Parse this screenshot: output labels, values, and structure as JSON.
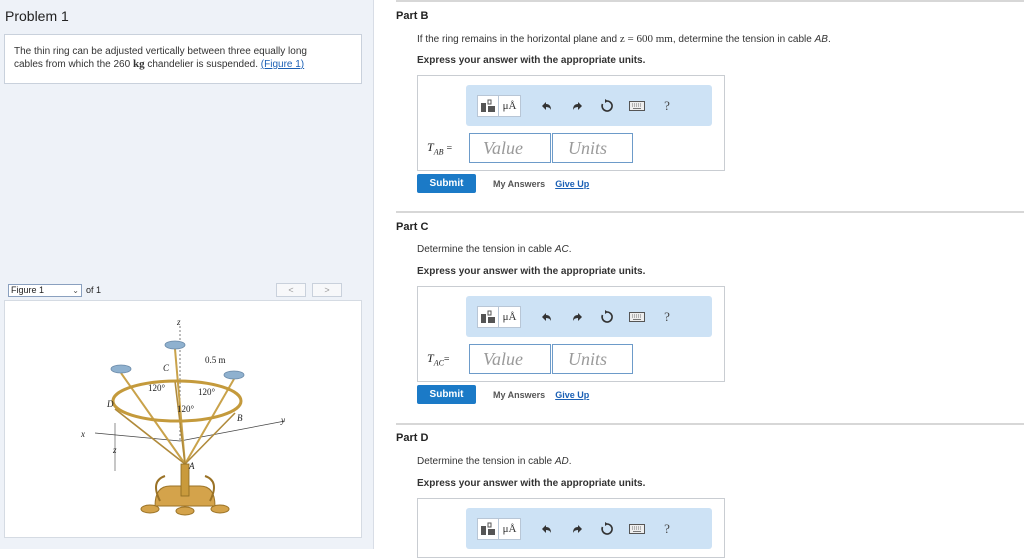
{
  "problem": {
    "title": "Problem 1",
    "intro_line1": "The thin ring can be adjusted vertically between three equally long",
    "intro_line2_pre": "cables from which the 260",
    "intro_unit": "kg",
    "intro_line2_post": "chandelier is suspended.",
    "figure_link": "(Figure 1)"
  },
  "figure_nav": {
    "select_value": "Figure 1",
    "of_text": "of 1",
    "prev": "<",
    "next": ">"
  },
  "figure": {
    "label_z_top": "z",
    "label_z_bottom": "z",
    "label_x": "x",
    "label_y": "y",
    "label_C": "C",
    "label_D": "D",
    "label_B": "B",
    "label_A": "A",
    "label_radius": "0.5 m",
    "angle1": "120°",
    "angle2": "120°",
    "angle3": "120°"
  },
  "parts": [
    {
      "label": "Part B",
      "question_pre": "If the ring remains in the horizontal plane and",
      "question_math": "z = 600 mm",
      "question_post": ", determine the tension in cable",
      "question_cable": "AB",
      "instruction": "Express your answer with the appropriate units.",
      "var_main": "T",
      "var_sub": "AB",
      "eq": "=",
      "value_placeholder": "Value",
      "units_placeholder": "Units",
      "submit": "Submit",
      "my_answers": "My Answers",
      "give_up": "Give Up"
    },
    {
      "label": "Part C",
      "question_pre": "Determine the tension in cable",
      "question_cable": "AC",
      "instruction": "Express your answer with the appropriate units.",
      "var_main": "T",
      "var_sub": "AC",
      "eq": "=",
      "value_placeholder": "Value",
      "units_placeholder": "Units",
      "submit": "Submit",
      "my_answers": "My Answers",
      "give_up": "Give Up"
    },
    {
      "label": "Part D",
      "question_pre": "Determine the tension in cable",
      "question_cable": "AD",
      "instruction": "Express your answer with the appropriate units."
    }
  ],
  "toolbar": {
    "mu_label": "μÅ",
    "help_label": "?",
    "icons": [
      "templates-icon",
      "symbols-icon",
      "undo-icon",
      "redo-icon",
      "reset-icon",
      "keyboard-icon",
      "help-icon"
    ]
  },
  "colors": {
    "toolbar_bg": "#cde2f5",
    "submit_bg": "#1b7ac7",
    "link": "#1a5fb4",
    "left_panel_bg": "#eef2f8"
  }
}
